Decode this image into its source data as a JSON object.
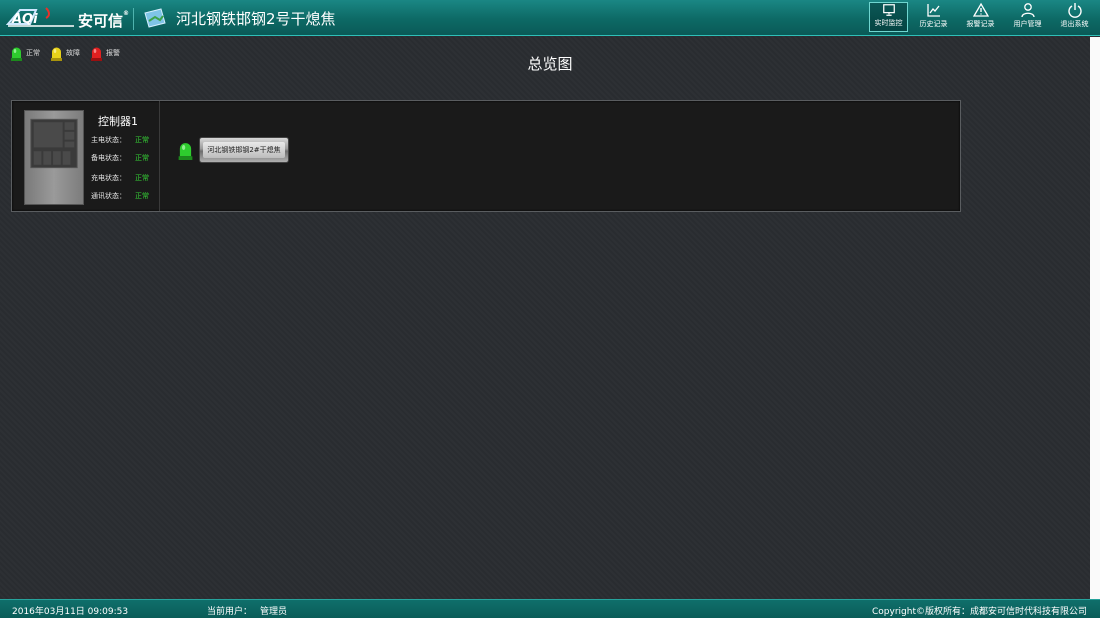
{
  "header": {
    "brand": "安可信",
    "title": "河北钢铁邯钢2号干熄焦",
    "nav": [
      {
        "label": "实时监控",
        "icon": "monitor-icon",
        "active": true
      },
      {
        "label": "历史记录",
        "icon": "chart-icon",
        "active": false
      },
      {
        "label": "报警记录",
        "icon": "warning-icon",
        "active": false
      },
      {
        "label": "用户管理",
        "icon": "user-icon",
        "active": false
      },
      {
        "label": "退出系统",
        "icon": "power-icon",
        "active": false
      }
    ]
  },
  "legend": [
    {
      "label": "正常",
      "color": "#2ecc2e"
    },
    {
      "label": "故障",
      "color": "#e8d21a"
    },
    {
      "label": "报警",
      "color": "#e02020"
    }
  ],
  "main": {
    "title": "总览图",
    "controller": {
      "name": "控制器1",
      "statuses": [
        {
          "key": "主电状态：",
          "value": "正常"
        },
        {
          "key": "备电状态：",
          "value": "正常"
        },
        {
          "key": "充电状态：",
          "value": "正常"
        },
        {
          "key": "通讯状态：",
          "value": "正常"
        }
      ],
      "station": {
        "label": "河北钢铁邯钢2#干熄焦",
        "status_color": "#2ecc2e"
      }
    }
  },
  "footer": {
    "datetime": "2016年03月11日 09:09:53",
    "user_label": "当前用户：",
    "user_value": "管理员",
    "copyright": "Copyright©版权所有：成都安可信时代科技有限公司"
  }
}
